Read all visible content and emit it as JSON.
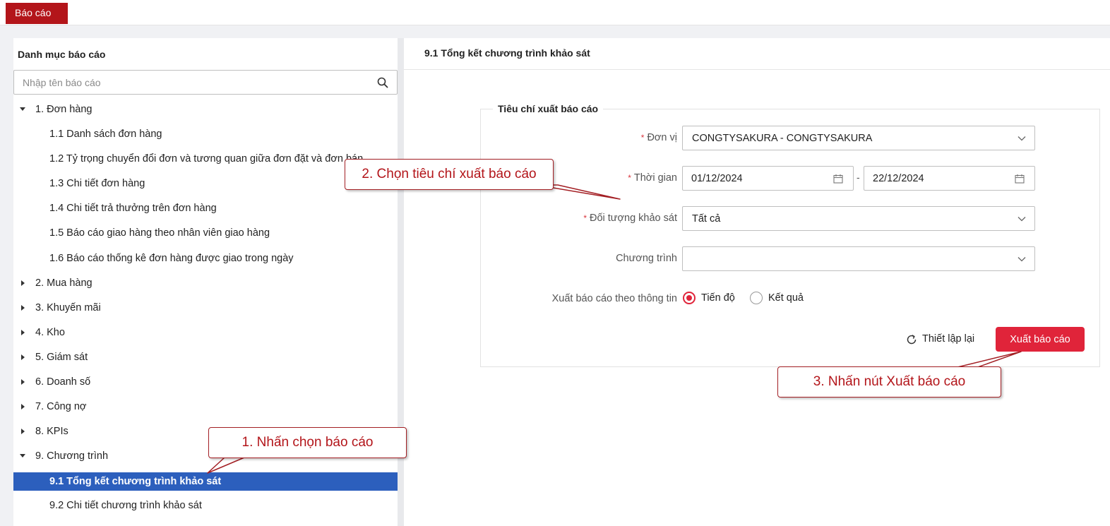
{
  "topbar": {
    "tab_label": "Báo cáo"
  },
  "sidebar": {
    "title": "Danh mục báo cáo",
    "search_placeholder": "Nhập tên báo cáo",
    "items": [
      {
        "label": "1. Đơn hàng",
        "level": 1,
        "expanded": true
      },
      {
        "label": "1.1 Danh sách đơn hàng",
        "level": 2
      },
      {
        "label": "1.2 Tỷ trọng chuyển đổi đơn và tương quan giữa đơn đặt và đơn bán",
        "level": 2
      },
      {
        "label": "1.3 Chi tiết đơn hàng",
        "level": 2
      },
      {
        "label": "1.4 Chi tiết trả thưởng trên đơn hàng",
        "level": 2
      },
      {
        "label": "1.5 Báo cáo giao hàng theo nhân viên giao hàng",
        "level": 2
      },
      {
        "label": "1.6 Báo cáo thống kê đơn hàng được giao trong ngày",
        "level": 2
      },
      {
        "label": "2. Mua hàng",
        "level": 1,
        "expanded": false
      },
      {
        "label": "3. Khuyến mãi",
        "level": 1,
        "expanded": false
      },
      {
        "label": "4. Kho",
        "level": 1,
        "expanded": false
      },
      {
        "label": "5. Giám sát",
        "level": 1,
        "expanded": false
      },
      {
        "label": "6. Doanh số",
        "level": 1,
        "expanded": false
      },
      {
        "label": "7. Công nợ",
        "level": 1,
        "expanded": false
      },
      {
        "label": "8. KPIs",
        "level": 1,
        "expanded": false
      },
      {
        "label": "9. Chương trình",
        "level": 1,
        "expanded": true
      },
      {
        "label": "9.1 Tổng kết chương trình khảo sát",
        "level": 2,
        "selected": true
      },
      {
        "label": "9.2 Chi tiết chương trình khảo sát",
        "level": 2
      }
    ]
  },
  "report": {
    "title": "9.1 Tổng kết chương trình khảo sát",
    "criteria_legend": "Tiêu chí xuất báo cáo",
    "unit_label": "Đơn vị",
    "unit_value": "CONGTYSAKURA - CONGTYSAKURA",
    "time_label": "Thời gian",
    "date_from": "01/12/2024",
    "date_separator": "-",
    "date_to": "22/12/2024",
    "target_label": "Đối tượng khảo sát",
    "target_value": "Tất cả",
    "program_label": "Chương trình",
    "program_value": "",
    "export_by_label": "Xuất báo cáo theo thông tin",
    "option_progress": "Tiến độ",
    "option_result": "Kết quả",
    "selected_option": "Tiến độ",
    "reset_label": "Thiết lập lại",
    "export_label": "Xuất báo cáo"
  },
  "callouts": {
    "step1": "1. Nhấn chọn báo cáo",
    "step2": "2. Chọn tiêu chí xuất báo cáo",
    "step3": "3. Nhấn nút Xuất báo cáo"
  },
  "colors": {
    "brand_red": "#b3151a",
    "button_red": "#e0243a",
    "selected_blue": "#2c5fbd",
    "required_red": "#d9363e"
  },
  "icons": [
    "search-icon",
    "caret-down-icon",
    "caret-right-icon",
    "chevron-down-icon",
    "calendar-icon",
    "reload-icon"
  ]
}
